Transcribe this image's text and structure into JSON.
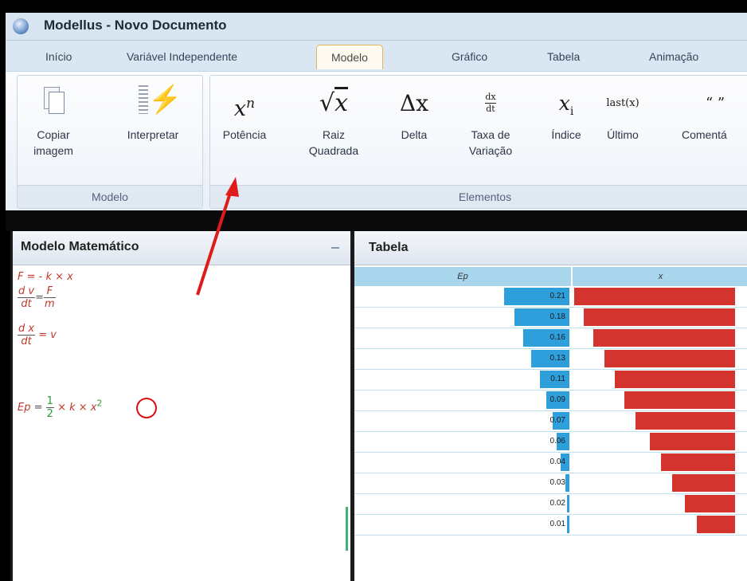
{
  "window": {
    "title": "Modellus - Novo Documento"
  },
  "tabs": [
    {
      "label": "Início"
    },
    {
      "label": "Variável Independente"
    },
    {
      "label": "Modelo"
    },
    {
      "label": "Gráfico"
    },
    {
      "label": "Tabela"
    },
    {
      "label": "Animação"
    }
  ],
  "ribbon": {
    "modelo_group": {
      "label": "Modelo",
      "copy_label_1": "Copiar",
      "copy_label_2": "imagem",
      "interpret_label": "Interpretar"
    },
    "elementos_group": {
      "label": "Elementos",
      "potencia": "Potência",
      "raiz_1": "Raiz",
      "raiz_2": "Quadrada",
      "delta": "Delta",
      "taxa_1": "Taxa de",
      "taxa_2": "Variação",
      "indice": "Índice",
      "ultimo": "Último",
      "comentario": "Comentá"
    }
  },
  "modelo_panel": {
    "title": "Modelo Matemático",
    "eq1": {
      "lhs": "F",
      "rhs": "= - k × x"
    },
    "eq2": {
      "num": "d v",
      "den": "dt",
      "rhs_num": "F",
      "rhs_den": "m"
    },
    "eq3": {
      "num": "d x",
      "den": "dt",
      "rhs": "= v"
    },
    "eq4": {
      "lhs": "Ep",
      "coef_num": "1",
      "coef_den": "2",
      "rest": "× k × x",
      "exp": "2"
    }
  },
  "tabela_panel": {
    "title": "Tabela",
    "columns": [
      "Ep",
      "x"
    ],
    "rows": [
      {
        "ep": "0.21",
        "ep_fill": 0.31,
        "x_fill": 1.0
      },
      {
        "ep": "0.18",
        "ep_fill": 0.26,
        "x_fill": 0.94
      },
      {
        "ep": "0.16",
        "ep_fill": 0.22,
        "x_fill": 0.88
      },
      {
        "ep": "0.13",
        "ep_fill": 0.18,
        "x_fill": 0.81
      },
      {
        "ep": "0.11",
        "ep_fill": 0.14,
        "x_fill": 0.75
      },
      {
        "ep": "0.09",
        "ep_fill": 0.11,
        "x_fill": 0.69
      },
      {
        "ep": "0.07",
        "ep_fill": 0.08,
        "x_fill": 0.62
      },
      {
        "ep": "0.06",
        "ep_fill": 0.06,
        "x_fill": 0.53
      },
      {
        "ep": "0.04",
        "ep_fill": 0.04,
        "x_fill": 0.46
      },
      {
        "ep": "0.03",
        "ep_fill": 0.02,
        "x_fill": 0.39
      },
      {
        "ep": "0.02",
        "ep_fill": 0.01,
        "x_fill": 0.31
      },
      {
        "ep": "0.01",
        "ep_fill": 0.005,
        "x_fill": 0.24
      }
    ]
  },
  "colors": {
    "ep_bar": "#2f9fdc",
    "x_bar": "#d4342e",
    "arrow": "#e01b1b"
  }
}
